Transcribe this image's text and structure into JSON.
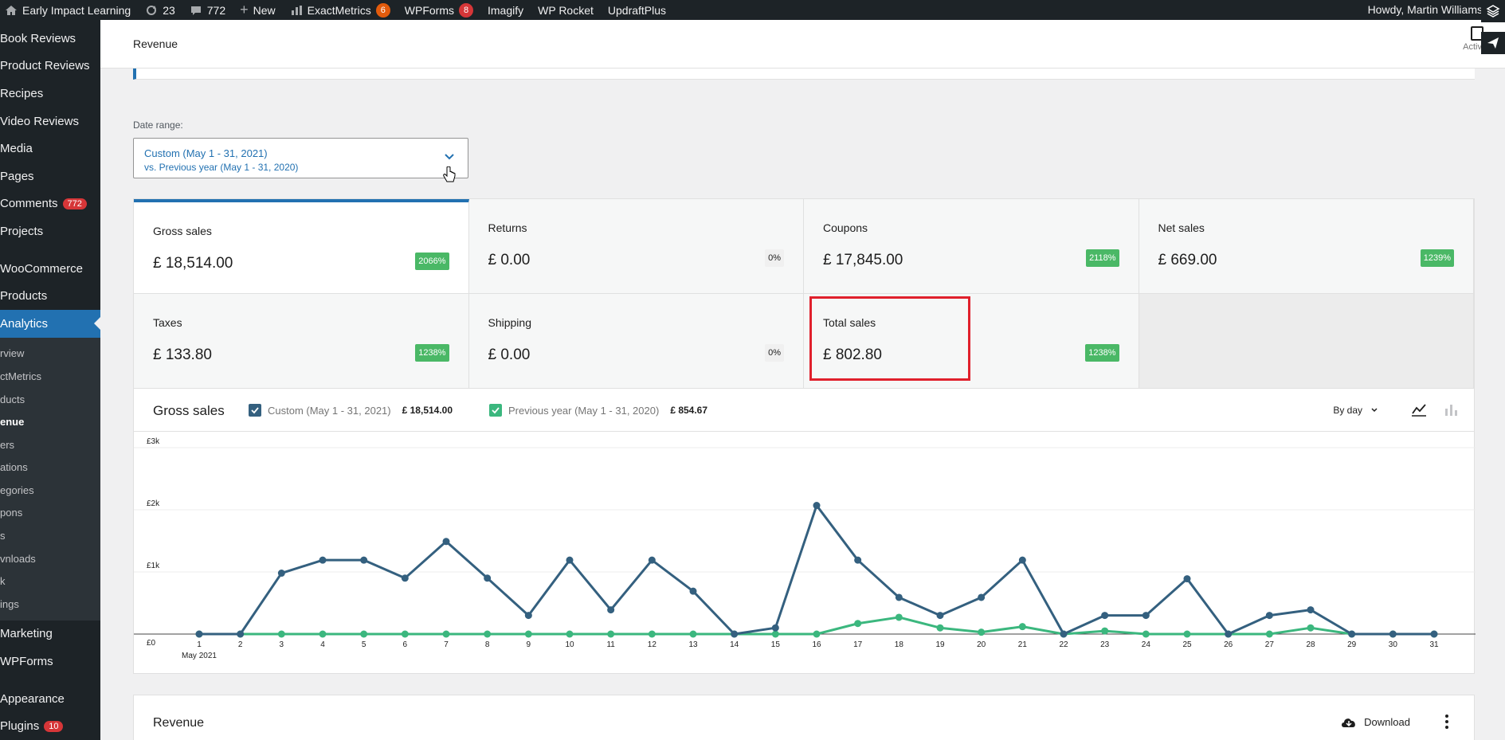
{
  "adminbar": {
    "site_name": "Early Impact Learning",
    "updates_count": "23",
    "comments_count": "772",
    "new_label": "New",
    "exactmetrics_label": "ExactMetrics",
    "exactmetrics_badge": "6",
    "wpforms_label": "WPForms",
    "wpforms_badge": "8",
    "imagify_label": "Imagify",
    "wprocket_label": "WP Rocket",
    "updraft_label": "UpdraftPlus",
    "howdy": "Howdy, Martin Williams"
  },
  "sidebar": {
    "items_top": [
      {
        "label": "Book Reviews"
      },
      {
        "label": "Product Reviews"
      },
      {
        "label": "Recipes"
      },
      {
        "label": "Video Reviews"
      },
      {
        "label": "Media"
      },
      {
        "label": "Pages"
      },
      {
        "label": "Comments",
        "badge": "772"
      },
      {
        "label": "Projects"
      }
    ],
    "items_woo": [
      {
        "label": "WooCommerce"
      },
      {
        "label": "Products"
      },
      {
        "label": "Analytics"
      }
    ],
    "submenu": [
      "rview",
      "ctMetrics",
      "ducts",
      "enue",
      "ers",
      "ations",
      "egories",
      "pons",
      "s",
      "vnloads",
      "k",
      "ings"
    ],
    "items_bottom": [
      {
        "label": "Marketing"
      },
      {
        "label": "WPForms"
      }
    ],
    "items_last": [
      {
        "label": "Appearance"
      },
      {
        "label": "Plugins",
        "badge": "10"
      }
    ]
  },
  "header": {
    "title": "Revenue",
    "activity_label": "Activity"
  },
  "date_range": {
    "label": "Date range:",
    "primary": "Custom (May 1 - 31, 2021)",
    "secondary": "vs. Previous year (May 1 - 31, 2020)"
  },
  "metrics": [
    {
      "label": "Gross sales",
      "value": "£ 18,514.00",
      "delta": "2066%"
    },
    {
      "label": "Returns",
      "value": "£ 0.00",
      "delta": "0%"
    },
    {
      "label": "Coupons",
      "value": "£ 17,845.00",
      "delta": "2118%"
    },
    {
      "label": "Net sales",
      "value": "£ 669.00",
      "delta": "1239%"
    },
    {
      "label": "Taxes",
      "value": "£ 133.80",
      "delta": "1238%"
    },
    {
      "label": "Shipping",
      "value": "£ 0.00",
      "delta": "0%"
    },
    {
      "label": "Total sales",
      "value": "£ 802.80",
      "delta": "1238%"
    }
  ],
  "chart_panel": {
    "title": "Gross sales",
    "interval": "By day",
    "legend": [
      {
        "label": "Custom (May 1 - 31, 2021)",
        "total": "£ 18,514.00",
        "color": "#34607f"
      },
      {
        "label": "Previous year (May 1 - 31, 2020)",
        "total": "£ 854.67",
        "color": "#3bb77e"
      }
    ]
  },
  "chart_data": {
    "type": "line",
    "x": [
      1,
      2,
      3,
      4,
      5,
      6,
      7,
      8,
      9,
      10,
      11,
      12,
      13,
      14,
      15,
      16,
      17,
      18,
      19,
      20,
      21,
      22,
      23,
      24,
      25,
      26,
      27,
      28,
      29,
      30,
      31
    ],
    "x_tick_sub": "May 2021",
    "y_ticks": [
      "£0",
      "£1k",
      "£2k",
      "£3k"
    ],
    "ylim": [
      0,
      3000
    ],
    "grid": true,
    "series": [
      {
        "name": "Custom (May 1 - 31, 2021)",
        "color": "#34607f",
        "values": [
          0,
          0,
          980,
          1190,
          1190,
          900,
          1490,
          900,
          300,
          1190,
          390,
          1190,
          690,
          0,
          100,
          2070,
          1190,
          590,
          300,
          590,
          1190,
          0,
          300,
          300,
          890,
          0,
          300,
          390,
          0,
          0,
          0
        ]
      },
      {
        "name": "Previous year (May 1 - 31, 2020)",
        "color": "#3bb77e",
        "values": [
          0,
          0,
          0,
          0,
          0,
          0,
          0,
          0,
          0,
          0,
          0,
          0,
          0,
          0,
          0,
          0,
          170,
          270,
          100,
          30,
          120,
          0,
          50,
          0,
          0,
          0,
          0,
          100,
          0,
          0,
          0
        ]
      }
    ]
  },
  "revenue_panel": {
    "title": "Revenue",
    "download_label": "Download"
  }
}
